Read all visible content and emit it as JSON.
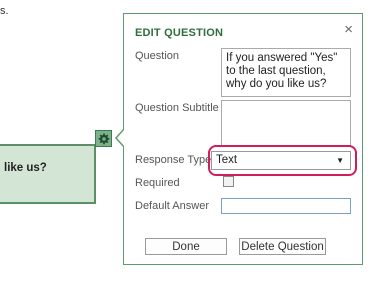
{
  "background": {
    "partial_text": "s."
  },
  "question_card": {
    "text": "like us?"
  },
  "dialog": {
    "title": "EDIT QUESTION",
    "close_glyph": "×",
    "fields": {
      "question_label": "Question",
      "question_value": "If you answered \"Yes\" to the last question, why do you like us?",
      "subtitle_label": "Question Subtitle",
      "subtitle_value": "",
      "response_type_label": "Response Type",
      "response_type_value": "Text",
      "required_label": "Required",
      "required_checked": false,
      "default_answer_label": "Default Answer",
      "default_answer_value": ""
    },
    "buttons": {
      "done": "Done",
      "delete": "Delete Question"
    }
  },
  "colors": {
    "accent_green": "#2f6e3c",
    "card_fill": "#d3e6d6",
    "highlight": "#d21c5d"
  },
  "icons": {
    "gear": "gear-icon",
    "close": "close-icon",
    "dropdown": "chevron-down-icon"
  }
}
